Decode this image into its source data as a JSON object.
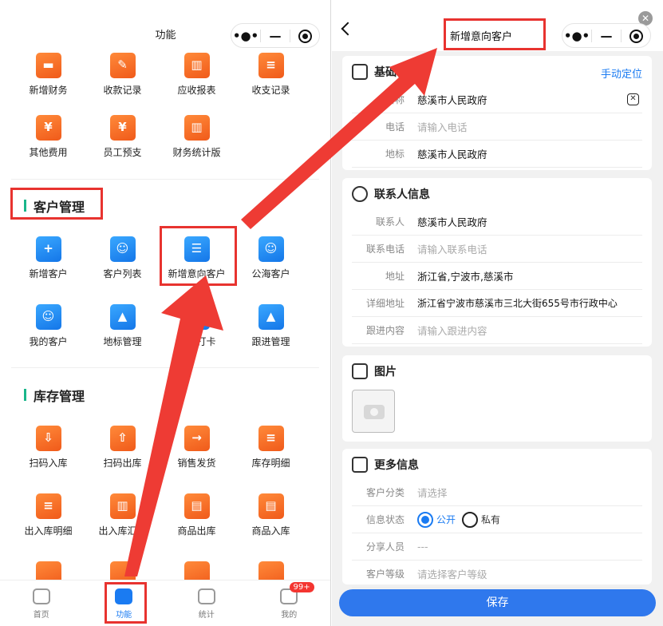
{
  "left": {
    "nav_title": "功能",
    "finance_items": [
      {
        "label": "新增财务",
        "icon": "wallet-icon",
        "glyph": "▬"
      },
      {
        "label": "收款记录",
        "icon": "receipt-edit-icon",
        "glyph": "✎"
      },
      {
        "label": "应收报表",
        "icon": "bar-report-icon",
        "glyph": "▥"
      },
      {
        "label": "收支记录",
        "icon": "ledger-icon",
        "glyph": "≡"
      },
      {
        "label": "其他费用",
        "icon": "yen-icon",
        "glyph": "¥"
      },
      {
        "label": "员工预支",
        "icon": "yen-ticket-icon",
        "glyph": "¥"
      },
      {
        "label": "财务统计版",
        "icon": "finance-stats-icon",
        "glyph": "▥"
      }
    ],
    "customer_section_title": "客户管理",
    "customer_items": [
      {
        "label": "新增客户",
        "icon": "add-user-icon",
        "glyph": "+"
      },
      {
        "label": "客户列表",
        "icon": "customer-card-icon",
        "glyph": "☺"
      },
      {
        "label": "新增意向客户",
        "icon": "intent-customer-icon",
        "glyph": "☰"
      },
      {
        "label": "公海客户",
        "icon": "public-customer-icon",
        "glyph": "☺"
      },
      {
        "label": "我的客户",
        "icon": "my-customer-icon",
        "glyph": "☺"
      },
      {
        "label": "地标管理",
        "icon": "landmark-icon",
        "glyph": "▲"
      },
      {
        "label": "外勤打卡",
        "icon": "checkin-icon",
        "glyph": "✓"
      },
      {
        "label": "跟进管理",
        "icon": "follow-up-icon",
        "glyph": "▲"
      }
    ],
    "inventory_section_title": "库存管理",
    "inventory_items": [
      {
        "label": "扫码入库",
        "icon": "scan-in-icon",
        "glyph": "⇩"
      },
      {
        "label": "扫码出库",
        "icon": "scan-out-icon",
        "glyph": "⇧"
      },
      {
        "label": "销售发货",
        "icon": "ship-icon",
        "glyph": "→"
      },
      {
        "label": "库存明细",
        "icon": "stock-detail-icon",
        "glyph": "≡"
      },
      {
        "label": "出入库明细",
        "icon": "io-detail-icon",
        "glyph": "≡"
      },
      {
        "label": "出入库汇总",
        "icon": "io-summary-icon",
        "glyph": "▥"
      },
      {
        "label": "商品出库",
        "icon": "goods-out-icon",
        "glyph": "▤"
      },
      {
        "label": "商品入库",
        "icon": "goods-in-icon",
        "glyph": "▤"
      }
    ],
    "tabbar": [
      {
        "label": "首页",
        "icon": "home-icon"
      },
      {
        "label": "功能",
        "icon": "cube-icon"
      },
      {
        "label": "统计",
        "icon": "stats-icon"
      },
      {
        "label": "我的",
        "icon": "profile-icon",
        "badge": "99+"
      }
    ]
  },
  "right": {
    "nav_title": "新增意向客户",
    "basic": {
      "title": "基础信息",
      "title_visible": "基础信",
      "locate_link": "手动定位",
      "rows": [
        {
          "label": "客户名称",
          "label_visible": "名称",
          "value": "慈溪市人民政府",
          "placeholder": ""
        },
        {
          "label": "电话",
          "value": "",
          "placeholder": "请输入电话"
        },
        {
          "label": "地标",
          "value": "慈溪市人民政府",
          "placeholder": ""
        }
      ]
    },
    "contact": {
      "title": "联系人信息",
      "rows": [
        {
          "label": "联系人",
          "value": "慈溪市人民政府",
          "placeholder": ""
        },
        {
          "label": "联系电话",
          "value": "",
          "placeholder": "请输入联系电话"
        },
        {
          "label": "地址",
          "value": "浙江省,宁波市,慈溪市",
          "placeholder": ""
        },
        {
          "label": "详细地址",
          "value": "浙江省宁波市慈溪市三北大街655号市行政中心",
          "placeholder": ""
        },
        {
          "label": "跟进内容",
          "value": "",
          "placeholder": "请输入跟进内容"
        }
      ]
    },
    "images": {
      "title": "图片"
    },
    "more": {
      "title": "更多信息",
      "category_label": "客户分类",
      "category_placeholder": "请选择",
      "status_label": "信息状态",
      "status_options": [
        "公开",
        "私有"
      ],
      "status_selected": "公开",
      "share_label": "分享人员",
      "share_value": "---",
      "level_label": "客户等级",
      "level_placeholder": "请选择客户等级"
    },
    "save_label": "保存"
  },
  "colors": {
    "accent": "#1a7bf2",
    "highlight_red": "#e8332f",
    "section_bar": "#19b68a",
    "icon_orange": "#f05a1a"
  }
}
